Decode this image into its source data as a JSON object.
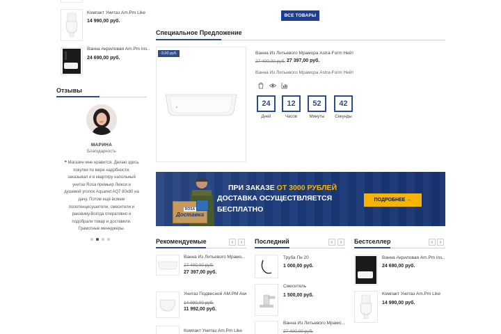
{
  "left_products": [
    {
      "name": "Компакт Унитаз Am.Pm Like",
      "price": "14 990,00 руб."
    },
    {
      "name": "Ванна Акриловая Am.Pm Ins...",
      "price": "24 690,00 руб."
    }
  ],
  "reviews": {
    "title": "Отзывы",
    "name": "МАРИНА",
    "role": "Благодарность",
    "text_lines": [
      "Магазин мне нравится. Делаю здесь",
      "покупки по мере надобности,",
      "заказывал и в квартиру напольный",
      "унитаз Rosa премьер Люкси и",
      "душевой уголок Aquanet AQ7 80x80 на",
      "дачу. Потом ещё всякие",
      "полотенцесушители, смесители и",
      "раковину.Всегда оперативно и",
      "подобрали товар и доставили.",
      "Грамотные менеджеры."
    ]
  },
  "all_products_button": "ВСЕ ТОВАРЫ",
  "special_offer": {
    "title": "Специальное Предложение",
    "badge": "-3,00 руб.",
    "product_name": "Ванна Из Литьевого Мрамора Astra-Form Нейт",
    "old_price": "27 400,00 руб.",
    "price": "27 397,00 руб.",
    "description": "Ванна Из Литьевого Мрамора Astra-Form Нейт",
    "countdown": [
      {
        "value": "24",
        "label": "Дней"
      },
      {
        "value": "12",
        "label": "Часов"
      },
      {
        "value": "52",
        "label": "Минуты"
      },
      {
        "value": "42",
        "label": "Секунды"
      }
    ]
  },
  "banner": {
    "line1_prefix": "ПРИ ЗАКАЗЕ ",
    "line1_highlight": "ОТ 3000 РУБЛЕЙ",
    "line2": "ДОСТАВКА ОСУЩЕСТВЛЯЕТСЯ",
    "line3": "БЕСПЛАТНО",
    "button": "ПОДРОБНЕЕ →",
    "box_text": "Доставка",
    "box_small": "ROSA"
  },
  "recommended": {
    "title": "Рекомендуемые",
    "items": [
      {
        "name": "Ванна Из Литьевого Мрамо...",
        "old": "27 400,00 руб.",
        "price": "27 397,00 руб."
      },
      {
        "name": "Унитаз Подвесной AM.PM Awe",
        "old": "14 990,00 руб.",
        "price": "11 992,00 руб."
      },
      {
        "name": "Компакт Унитаз Am.Pm Like",
        "old": "",
        "price": ""
      }
    ]
  },
  "latest": {
    "title": "Последний",
    "items": [
      {
        "name": "Труба Пн 20",
        "old": "",
        "price": "1 000,00 руб."
      },
      {
        "name": "Смеситель",
        "old": "",
        "price": "1 500,00 руб."
      },
      {
        "name": "Ванна Из Литьевого Мрамо...",
        "old": "27 400,00 руб.",
        "price": ""
      }
    ]
  },
  "bestseller": {
    "title": "Бестселлер",
    "items": [
      {
        "name": "Ванна Акриловая Am.Pm Ins...",
        "old": "",
        "price": "24 690,00 руб."
      },
      {
        "name": "Компакт Унитаз Am.Pm Like",
        "old": "",
        "price": "14 990,00 руб."
      }
    ]
  },
  "arrows": {
    "prev": "‹",
    "next": "›"
  },
  "colors": {
    "accent": "#2c4a8c",
    "button": "#1e3f8f",
    "banner_bg": "#1c3a7a",
    "banner_highlight": "#f5b400",
    "banner_button": "#f5b400"
  }
}
